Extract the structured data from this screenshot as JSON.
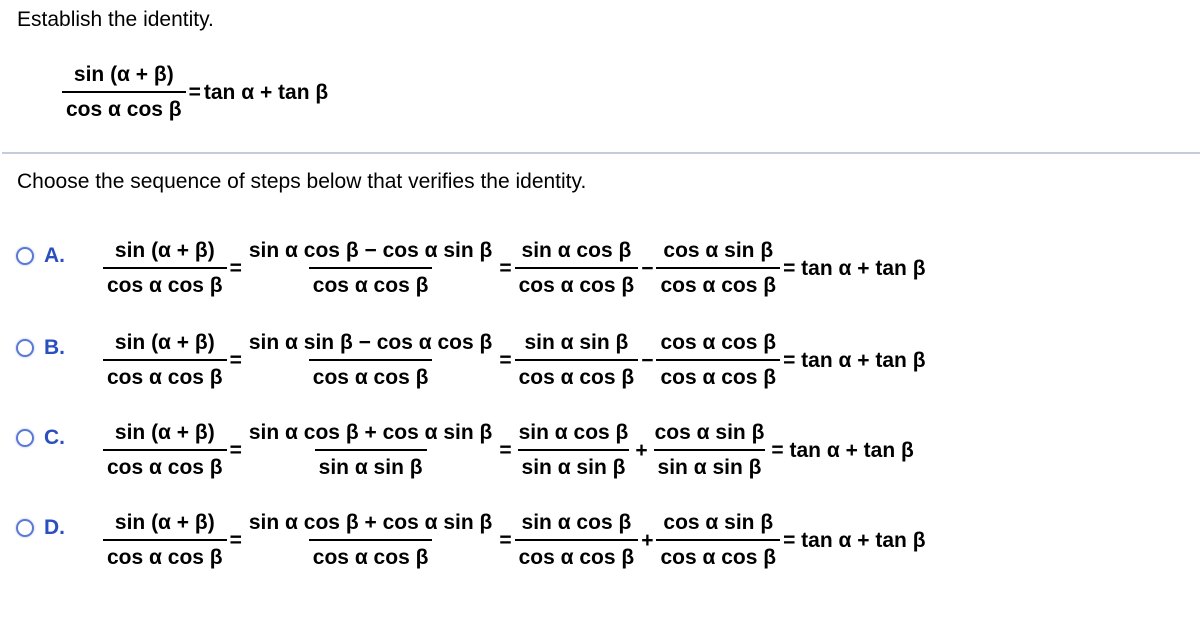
{
  "question": {
    "intro": "Establish the identity.",
    "identity": {
      "lhs_num": "sin (α + β)",
      "lhs_den": "cos  α cos  β",
      "eq": "=",
      "rhs": "tan  α + tan  β"
    },
    "instruction": "Choose the sequence of steps below that verifies the identity."
  },
  "options": [
    {
      "letter": "A.",
      "f1_num": "sin (α + β)",
      "f1_den": "cos  α cos  β",
      "f2_num": "sin  α cos  β − cos  α sin  β",
      "f2_den": "cos  α cos  β",
      "f3_num": "sin  α cos  β",
      "f3_den": "cos  α cos  β",
      "op": "−",
      "f4_num": "cos  α sin  β",
      "f4_den": "cos  α cos  β",
      "rhs": "= tan  α + tan  β",
      "eq": "="
    },
    {
      "letter": "B.",
      "f1_num": "sin (α + β)",
      "f1_den": "cos  α cos  β",
      "f2_num": "sin  α sin  β − cos  α cos  β",
      "f2_den": "cos  α cos  β",
      "f3_num": "sin  α sin  β",
      "f3_den": "cos  α cos  β",
      "op": "−",
      "f4_num": "cos  α cos  β",
      "f4_den": "cos  α cos  β",
      "rhs": "= tan  α + tan  β",
      "eq": "="
    },
    {
      "letter": "C.",
      "f1_num": "sin (α + β)",
      "f1_den": "cos  α cos  β",
      "f2_num": "sin  α cos  β + cos  α sin  β",
      "f2_den": "sin  α sin  β",
      "f3_num": "sin  α cos  β",
      "f3_den": "sin  α sin  β",
      "op": "+",
      "f4_num": "cos  α sin  β",
      "f4_den": "sin  α sin  β",
      "rhs": "= tan  α + tan  β",
      "eq": "="
    },
    {
      "letter": "D.",
      "f1_num": "sin (α + β)",
      "f1_den": "cos  α cos  β",
      "f2_num": "sin  α cos  β + cos  α sin  β",
      "f2_den": "cos  α cos  β",
      "f3_num": "sin  α cos  β",
      "f3_den": "cos  α cos  β",
      "op": "+",
      "f4_num": "cos  α sin  β",
      "f4_den": "cos  α cos  β",
      "rhs": "= tan  α + tan  β",
      "eq": "="
    }
  ],
  "colors": {
    "radio_border": "#5a78d4",
    "letter": "#2c4fc0",
    "divider": "#c3cbdc"
  }
}
